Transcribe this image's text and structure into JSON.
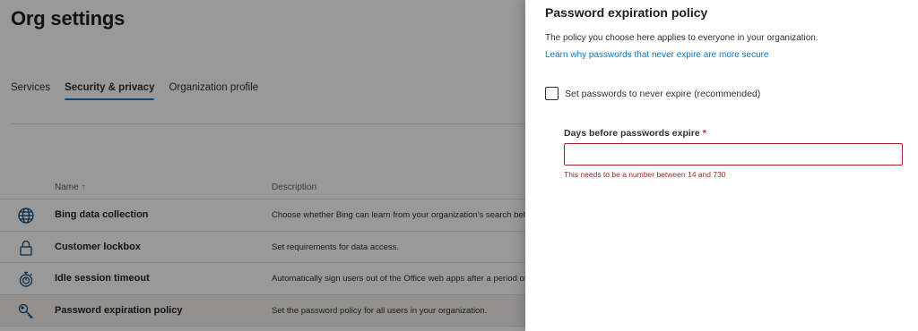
{
  "page": {
    "title": "Org settings",
    "tabs": [
      {
        "label": "Services"
      },
      {
        "label": "Security & privacy"
      },
      {
        "label": "Organization profile"
      }
    ],
    "active_tab": "Security & privacy",
    "grid": {
      "col_name": "Name ↑",
      "col_description": "Description",
      "rows": [
        {
          "name": "Bing data collection",
          "description": "Choose whether Bing can learn from your organization's search behavior",
          "icon": "globe-icon"
        },
        {
          "name": "Customer lockbox",
          "description": "Set requirements for data access.",
          "icon": "lock-icon"
        },
        {
          "name": "Idle session timeout",
          "description": "Automatically sign users out of the Office web apps after a period of inactivity",
          "icon": "stopwatch-icon"
        },
        {
          "name": "Password expiration policy",
          "description": "Set the password policy for all users in your organization.",
          "icon": "key-icon"
        }
      ],
      "selected_row": "Password expiration policy"
    }
  },
  "panel": {
    "title": "Password expiration policy",
    "description": "The policy you choose here applies to everyone in your organization.",
    "link": "Learn why passwords that never expire are more secure",
    "checkbox_label": "Set passwords to never expire (recommended)",
    "checkbox_checked": false,
    "field_label": "Days before passwords expire",
    "required_marker": "*",
    "field_value": "",
    "error_text": "This needs to be a number between 14 and 730"
  },
  "colors": {
    "accent": "#0078d4",
    "error": "#a4262c",
    "overlay": "rgba(0,0,0,0.40)"
  }
}
